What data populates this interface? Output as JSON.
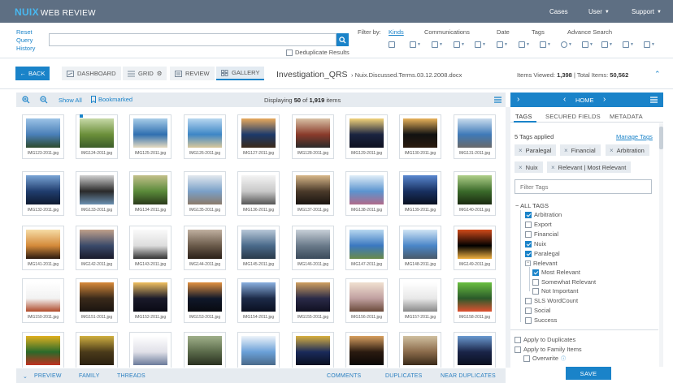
{
  "app": {
    "brand_nuix": "NUIX",
    "brand_product": "WEB REVIEW"
  },
  "topnav": {
    "cases": "Cases",
    "user": "User",
    "support": "Support"
  },
  "search": {
    "reset": "Reset",
    "query": "Query",
    "history": "History",
    "value": "",
    "placeholder": "",
    "dedup_label": "Deduplicate Results",
    "filter_by": "Filter by:",
    "filter_tabs": [
      "Kinds",
      "Communications",
      "Date",
      "Tags",
      "Advance Search"
    ]
  },
  "toolbar": {
    "back": "BACK",
    "tabs": [
      "DASHBOARD",
      "GRID",
      "REVIEW",
      "GALLERY"
    ],
    "title": "Investigation_QRS",
    "path": "Nuix.Discussed.Terms.03.12.2008.docx",
    "items_viewed_label": "Items Viewed:",
    "items_viewed": "1,398",
    "total_items_label": "Total Items:",
    "total_items": "50,562"
  },
  "gallery": {
    "show_all": "Show All",
    "bookmarked": "Bookmarked",
    "displaying_prefix": "Displaying",
    "displaying_count": "50",
    "displaying_of": "of",
    "displaying_total": "1,919",
    "displaying_suffix": "items",
    "items": [
      "IMG123-2011.jpg",
      "IMG124-2011.jpg",
      "IMG125-2011.jpg",
      "IMG126-2011.jpg",
      "IMG127-2011.jpg",
      "IMG128-2011.jpg",
      "IMG129-2011.jpg",
      "IMG130-2011.jpg",
      "IMG131-2011.jpg",
      "IMG132-2011.jpg",
      "IMG133-2011.jpg",
      "IMG134-2011.jpg",
      "IMG135-2011.jpg",
      "IMG136-2011.jpg",
      "IMG137-2011.jpg",
      "IMG138-2011.jpg",
      "IMG139-2011.jpg",
      "IMG140-2011.jpg",
      "IMG141-2011.jpg",
      "IMG142-2011.jpg",
      "IMG143-2011.jpg",
      "IMG144-2011.jpg",
      "IMG145-2011.jpg",
      "IMG146-2011.jpg",
      "IMG147-2011.jpg",
      "IMG148-2011.jpg",
      "IMG149-2011.jpg",
      "IMG150-2011.jpg",
      "IMG151-2011.jpg",
      "IMG152-2011.jpg",
      "IMG153-2011.jpg",
      "IMG154-2011.jpg",
      "IMG155-2011.jpg",
      "IMG156-2011.jpg",
      "IMG157-2011.jpg",
      "IMG158-2011.jpg",
      "",
      "",
      "",
      "",
      "",
      "",
      "",
      "",
      ""
    ]
  },
  "bottom_tabs": {
    "preview": "PREVIEW",
    "family": "FAMILY",
    "threads": "THREADS",
    "comments": "COMMENTS",
    "duplicates": "DUPLICATES",
    "near_duplicates": "NEAR DUPLICATES"
  },
  "right_panel": {
    "home": "HOME",
    "tabs": [
      "TAGS",
      "SECURED FIELDS",
      "METADATA"
    ],
    "tags_applied": "5 Tags applied",
    "manage_tags": "Manage Tags",
    "chips": [
      "Paralegal",
      "Financial",
      "Arbitration",
      "Nuix",
      "Relevant | Most Relevant"
    ],
    "filter_placeholder": "Filter Tags",
    "all_tags": "ALL TAGS",
    "tags": [
      {
        "label": "Arbitration",
        "checked": true
      },
      {
        "label": "Export",
        "checked": false
      },
      {
        "label": "Financial",
        "checked": false
      },
      {
        "label": "Nuix",
        "checked": true
      },
      {
        "label": "Paralegal",
        "checked": true
      },
      {
        "label": "Relevant",
        "checked": false
      },
      {
        "label": "Most Relevant",
        "checked": true
      },
      {
        "label": "Somewhat Relevant",
        "checked": false
      },
      {
        "label": "Not Important",
        "checked": false
      },
      {
        "label": "SLS WordCount",
        "checked": false
      },
      {
        "label": "Social",
        "checked": false
      },
      {
        "label": "Success",
        "checked": false
      }
    ],
    "apply_duplicates": "Apply to Duplicates",
    "apply_family": "Apply to Family Items",
    "overwrite": "Overwrite",
    "save": "SAVE"
  },
  "colors": {
    "topbar": "#5e6f83",
    "accent": "#1a83c9",
    "panel": "#e6ebf0"
  }
}
